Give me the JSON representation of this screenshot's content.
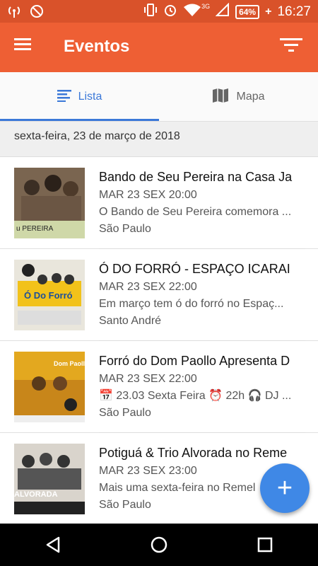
{
  "status_bar": {
    "battery": "64%",
    "time": "16:27",
    "signal_label": "3G"
  },
  "app_bar": {
    "title": "Eventos",
    "menu_icon": "hamburger-menu-icon",
    "filter_icon": "filter-icon",
    "color": "#ee5f34"
  },
  "tabs": [
    {
      "label": "Lista",
      "icon": "list-icon",
      "active": true
    },
    {
      "label": "Mapa",
      "icon": "map-icon",
      "active": false
    }
  ],
  "date_header": "sexta-feira, 23 de março de 2018",
  "events": [
    {
      "title": "Bando de Seu Pereira na Casa Ja",
      "datetime": "MAR 23 SEX 20:00",
      "description": "O Bando de Seu Pereira comemora ...",
      "city": "São Paulo",
      "thumb_caption": "u PEREIRA"
    },
    {
      "title": "Ó DO FORRÓ - ESPAÇO ICARAI",
      "datetime": "MAR 23 SEX 22:00",
      "description": "Em março tem ó do forró no Espaç...",
      "city": "Santo André",
      "thumb_caption": "Ó Do Forró"
    },
    {
      "title": "Forró do Dom Paollo Apresenta D",
      "datetime": "MAR 23 SEX 22:00",
      "description": "📅 23.03 Sexta Feira ⏰ 22h 🎧 DJ ...",
      "city": "São Paulo",
      "thumb_caption": "Dom Paollo"
    },
    {
      "title": "Potiguá & Trio Alvorada no Reme",
      "datetime": "MAR 23 SEX 23:00",
      "description": "Mais uma sexta-feira no Remel",
      "city": "São Paulo",
      "thumb_caption": "ALVORADA"
    }
  ],
  "fab_label": "+"
}
